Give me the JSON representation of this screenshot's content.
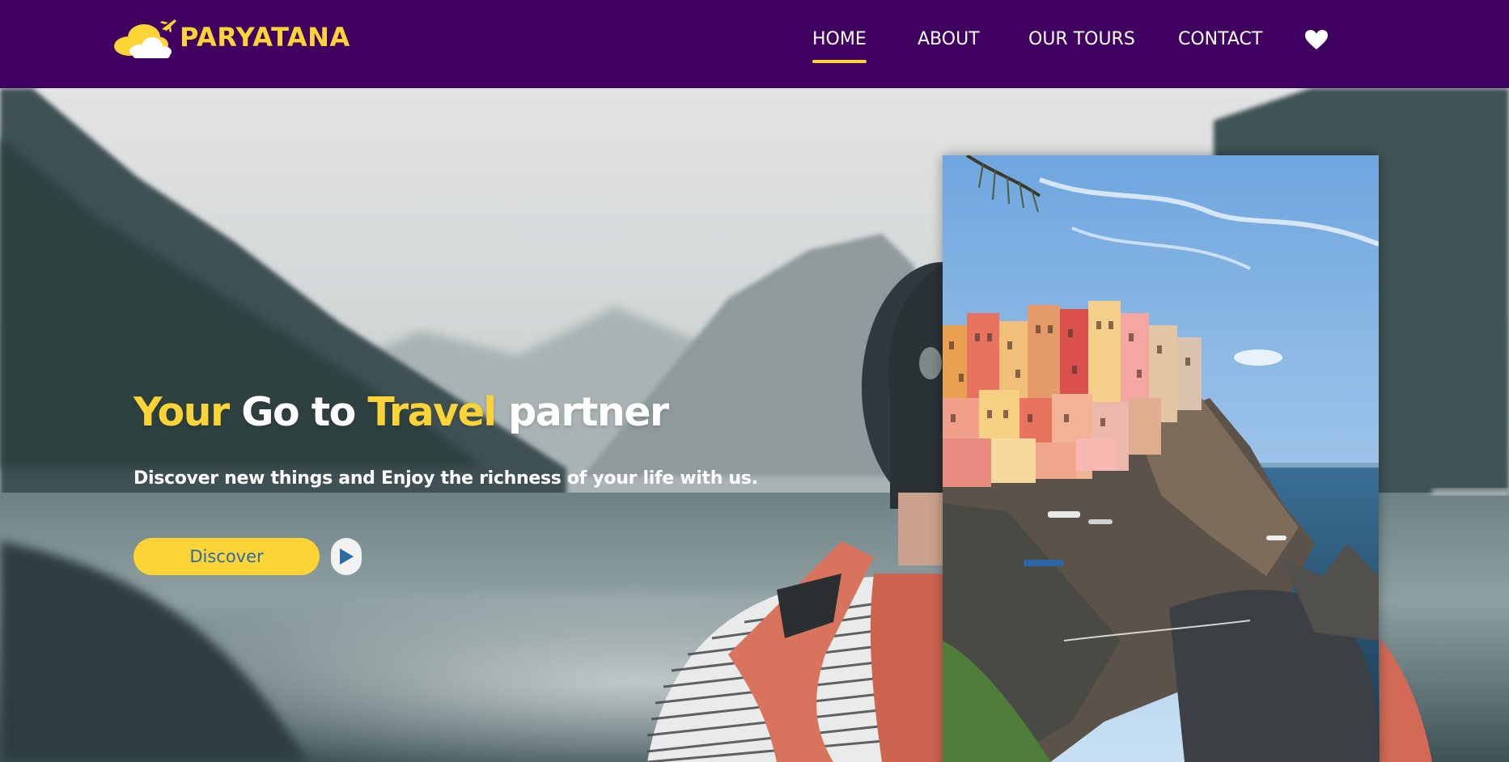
{
  "brand": {
    "name": "PARYATANA",
    "logo_icon": "cloud-plane-logo",
    "color": "#fcd436"
  },
  "nav": {
    "background": "#400060",
    "links": [
      {
        "label": "HOME",
        "active": true
      },
      {
        "label": "ABOUT",
        "active": false
      },
      {
        "label": "OUR TOURS",
        "active": false
      },
      {
        "label": "CONTACT",
        "active": false
      }
    ],
    "wishlist_icon": "heart-icon"
  },
  "hero": {
    "headline": {
      "word1": "Your",
      "word2": "Go to",
      "word3": "Travel",
      "word4": "partner"
    },
    "subline": "Discover new things and Enjoy the richness of your life with us.",
    "cta_label": "Discover",
    "play_icon": "play-icon",
    "accent": "#fcd436",
    "background_image": "traveler-lake-mountains-photo",
    "card_image": "cliffside-village-photo"
  }
}
